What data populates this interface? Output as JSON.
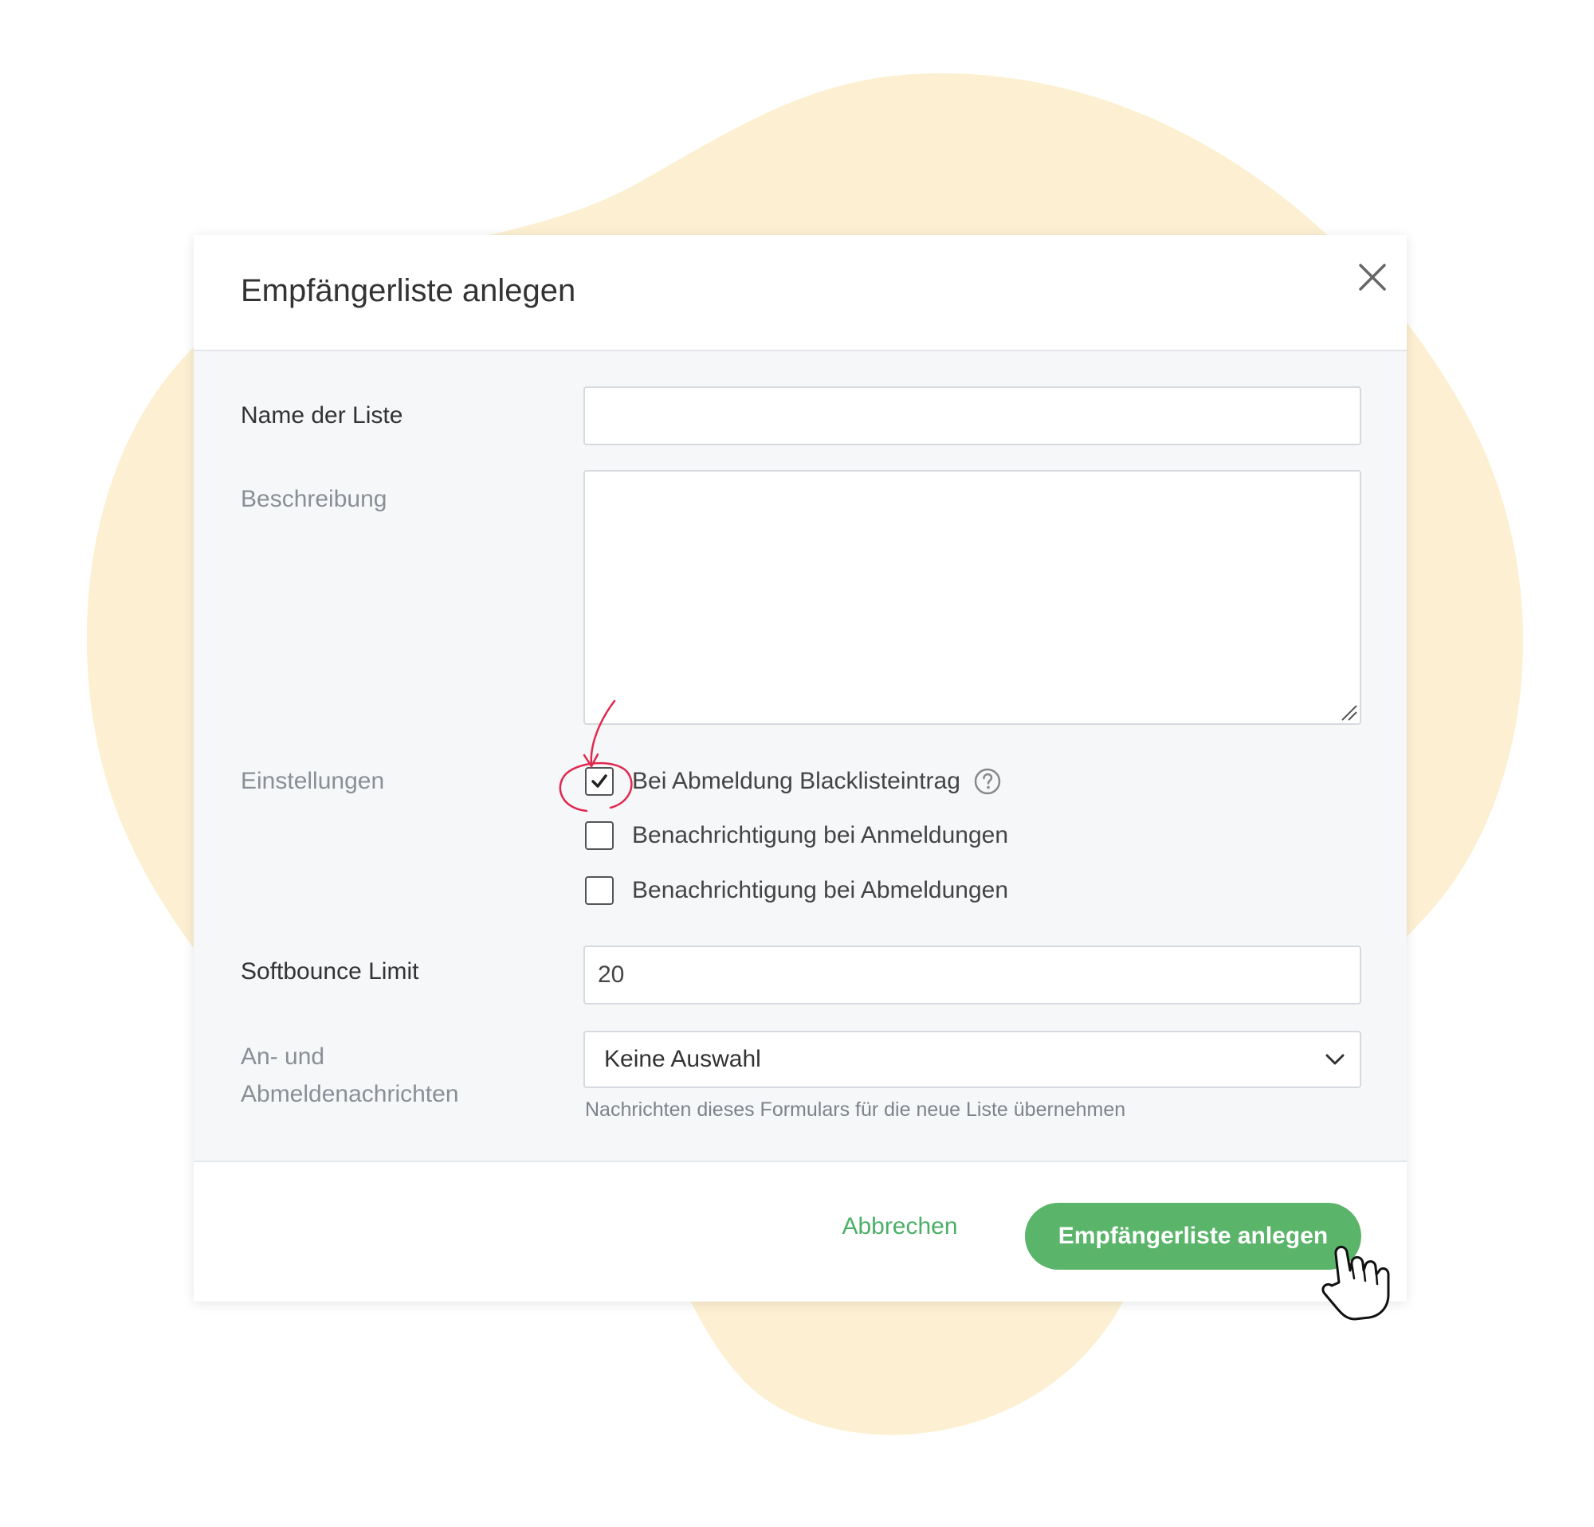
{
  "dialog": {
    "title": "Empfängerliste anlegen",
    "close_icon": "close-icon"
  },
  "form": {
    "name_label": "Name der Liste",
    "name_value": "",
    "description_label": "Beschreibung",
    "description_value": "",
    "settings_label": "Einstellungen",
    "settings_options": [
      {
        "label": "Bei Abmeldung Blacklisteintrag",
        "checked": true,
        "help_icon": "question-circle-icon"
      },
      {
        "label": "Benachrichtigung bei Anmeldungen",
        "checked": false
      },
      {
        "label": "Benachrichtigung bei Abmeldungen",
        "checked": false
      }
    ],
    "softbounce_label": "Softbounce Limit",
    "softbounce_value": "20",
    "messages_label_line1": "An- und",
    "messages_label_line2": "Abmeldenachrichten",
    "messages_select_value": "Keine Auswahl",
    "messages_hint": "Nachrichten dieses Formulars für die neue Liste übernehmen"
  },
  "footer": {
    "cancel_label": "Abbrechen",
    "submit_label": "Empfängerliste anlegen"
  },
  "colors": {
    "accent_green": "#5ab56a",
    "link_green": "#4caf68",
    "annotation_red": "#e0284f",
    "background_blob": "#fdf0d2"
  },
  "annotations": {
    "arrow_circle": "red-annotation-circle-arrow",
    "cursor": "hand-pointer-icon"
  }
}
